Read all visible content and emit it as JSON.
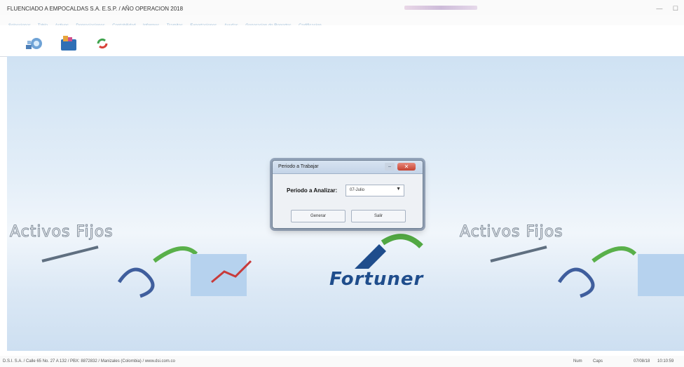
{
  "window": {
    "title": "FLUENCIADO A EMPOCALDAS S.A. E.S.P. / AÑO OPERACION 2018",
    "controls": [
      "—",
      "☐"
    ]
  },
  "menu": {
    "items": [
      "Seleccionar",
      "Tabla",
      "Activos",
      "Depreciaciones",
      "Contabilidad",
      "Informes",
      "Tramites",
      "Exportaciones",
      "Ayudas",
      "Generacion de Reportes",
      "Codificacion"
    ]
  },
  "toolbar": {
    "tools": [
      "network-icon",
      "folder-icon",
      "refresh-icon"
    ]
  },
  "desktop": {
    "banner_left": "Activos Fijos",
    "banner_right": "Activos Fijos",
    "brand": "Fortuner"
  },
  "dialog": {
    "title": "Periodo a Trabajar",
    "field_label": "Periodo a Analizar:",
    "selected_period": "07-Julio",
    "generate_label": "Generar",
    "exit_label": "Salir"
  },
  "status": {
    "left": "D.S.I. S.A. / Calle 65 No. 27 A 132 / PBX: 8872832 / Manizales (Colombia) / www.dsi.com.co",
    "num": "Num",
    "caps": "Caps",
    "date": "07/08/18",
    "time": "10:10:59"
  },
  "colors": {
    "desktop_top": "#cfe2f3",
    "brand_blue": "#1f4d8c",
    "close_red": "#c4402f"
  }
}
